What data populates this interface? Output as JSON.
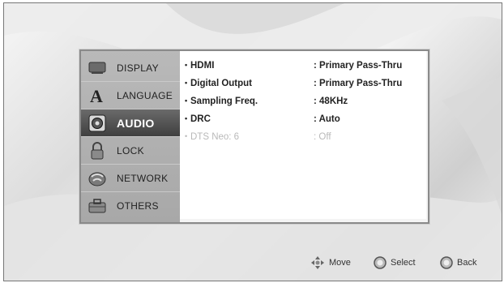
{
  "sidebar": {
    "items": [
      {
        "label": "DISPLAY",
        "icon": "display-icon",
        "active": false
      },
      {
        "label": "LANGUAGE",
        "icon": "language-icon",
        "active": false
      },
      {
        "label": "AUDIO",
        "icon": "audio-icon",
        "active": true
      },
      {
        "label": "LOCK",
        "icon": "lock-icon",
        "active": false
      },
      {
        "label": "NETWORK",
        "icon": "network-icon",
        "active": false
      },
      {
        "label": "OTHERS",
        "icon": "others-icon",
        "active": false
      }
    ]
  },
  "settings": {
    "rows": [
      {
        "label": "HDMI",
        "value": ": Primary Pass-Thru",
        "enabled": true
      },
      {
        "label": "Digital Output",
        "value": ": Primary Pass-Thru",
        "enabled": true
      },
      {
        "label": "Sampling Freq.",
        "value": ": 48KHz",
        "enabled": true
      },
      {
        "label": "DRC",
        "value": ": Auto",
        "enabled": true
      },
      {
        "label": "DTS Neo: 6",
        "value": ": Off",
        "enabled": false
      }
    ]
  },
  "footer": {
    "move_label": "Move",
    "select_label": "Select",
    "back_label": "Back"
  },
  "colors": {
    "active_item": "#4a4a4a",
    "sidebar": "#b0b0b0",
    "disabled_text": "#b9b9b9"
  }
}
